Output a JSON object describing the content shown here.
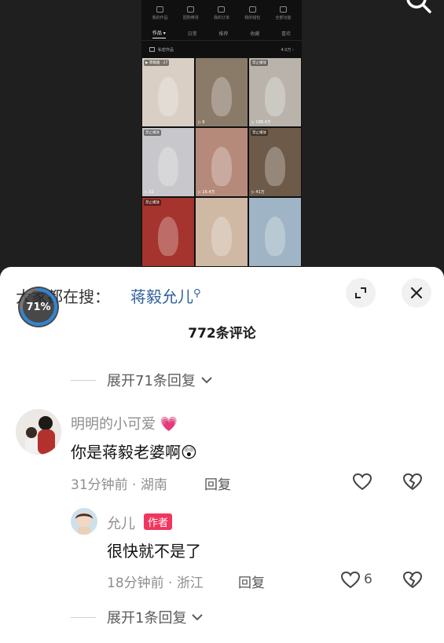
{
  "profile": {
    "tools": [
      "我的作品",
      "团购带货",
      "我的订单",
      "我的钱包",
      "全部功能"
    ],
    "tabs": [
      "作品 ▾",
      "日常",
      "推荐",
      "收藏",
      "喜欢"
    ],
    "active_tab": "作品 ▾",
    "collection": {
      "label": "私密作品",
      "right": "4.0万 ›"
    },
    "thumbs": [
      {
        "tag": "▶ 草稿箱 · 27",
        "count": "",
        "bg": "#d9cfc4"
      },
      {
        "tag": "",
        "count": "▷ 6",
        "bg": "#8a7a68"
      },
      {
        "tag": "禁止播放",
        "count": "▷ 188.4万",
        "bg": "#b9b3ab"
      },
      {
        "tag": "禁止播放",
        "count": "▷ 32",
        "bg": "#c8c8cc"
      },
      {
        "tag": "",
        "count": "▷ 16.4万",
        "bg": "#b58a7b"
      },
      {
        "tag": "禁止播放",
        "count": "▷ 41万",
        "bg": "#6d5a48"
      },
      {
        "tag": "禁止播放",
        "count": "",
        "bg": "#a4342d"
      },
      {
        "tag": "",
        "count": "",
        "bg": "#cfb9a5"
      },
      {
        "tag": "",
        "count": "",
        "bg": "#9fb4c4"
      }
    ]
  },
  "sheet": {
    "search_prefix": "大家都在搜：",
    "search_term": "蒋毅允儿",
    "progress_percent": 71,
    "progress_label": "71%",
    "comment_count": "772条评论",
    "expand_top": "展开71条回复",
    "expand_bottom": "展开1条回复"
  },
  "comments": [
    {
      "user": "明明的小可爱",
      "text": "你是蒋毅老婆啊",
      "emoji": "😲",
      "meta": "31分钟前 · 湖南",
      "reply": "回复",
      "likes": ""
    },
    {
      "user": "允儿",
      "badge": "作者",
      "text": "很快就不是了",
      "meta": "18分钟前 · 浙江",
      "reply": "回复",
      "likes": "6"
    }
  ],
  "colors": {
    "accent_link": "#2f5f9a",
    "author_badge": "#f2355f",
    "progress_ring": "#2f86d6"
  }
}
